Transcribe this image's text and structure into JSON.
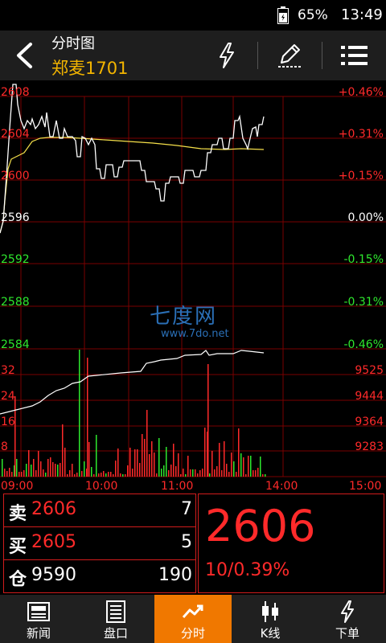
{
  "status_bar": {
    "battery": "65%",
    "time": "13:49"
  },
  "header": {
    "title": "分时图",
    "contract": "郑麦1701",
    "icons": [
      "back-arrow-icon",
      "lightning-icon",
      "pencil-icon",
      "menu-icon"
    ]
  },
  "chart": {
    "price_labels": [
      "2608",
      "2604",
      "2600",
      "2596",
      "2592",
      "2588",
      "2584"
    ],
    "pct_labels": [
      "+0.46%",
      "+0.31%",
      "+0.15%",
      "0.00%",
      "-0.15%",
      "-0.31%",
      "-0.46%"
    ],
    "volume_labels_left": [
      "32",
      "24",
      "16",
      "8"
    ],
    "volume_labels_right": [
      "9525",
      "9444",
      "9364",
      "9283"
    ],
    "time_labels": [
      "09:00",
      "10:00",
      "11:00",
      "14:00",
      "15:00"
    ],
    "watermark": "七度网",
    "watermark_url": "www.7do.net",
    "colors": {
      "up": "#ff2a2a",
      "down": "#2ee82e",
      "grid": "#7a0000",
      "avg_line": "#f5e04a",
      "price_line": "#ffffff"
    }
  },
  "quote": {
    "sell_label": "卖",
    "sell_price": "2606",
    "sell_volume": "7",
    "buy_label": "买",
    "buy_price": "2605",
    "buy_volume": "5",
    "oi_label": "仓",
    "oi_value": "9590",
    "oi_change": "190",
    "last_price": "2606",
    "change": "10/0.39%"
  },
  "tabs": [
    {
      "label": "新闻",
      "icon": "news-icon"
    },
    {
      "label": "盘口",
      "icon": "orderbook-icon"
    },
    {
      "label": "分时",
      "icon": "trend-icon",
      "active": true
    },
    {
      "label": "K线",
      "icon": "candlestick-icon"
    },
    {
      "label": "下单",
      "icon": "lightning-icon"
    }
  ]
}
